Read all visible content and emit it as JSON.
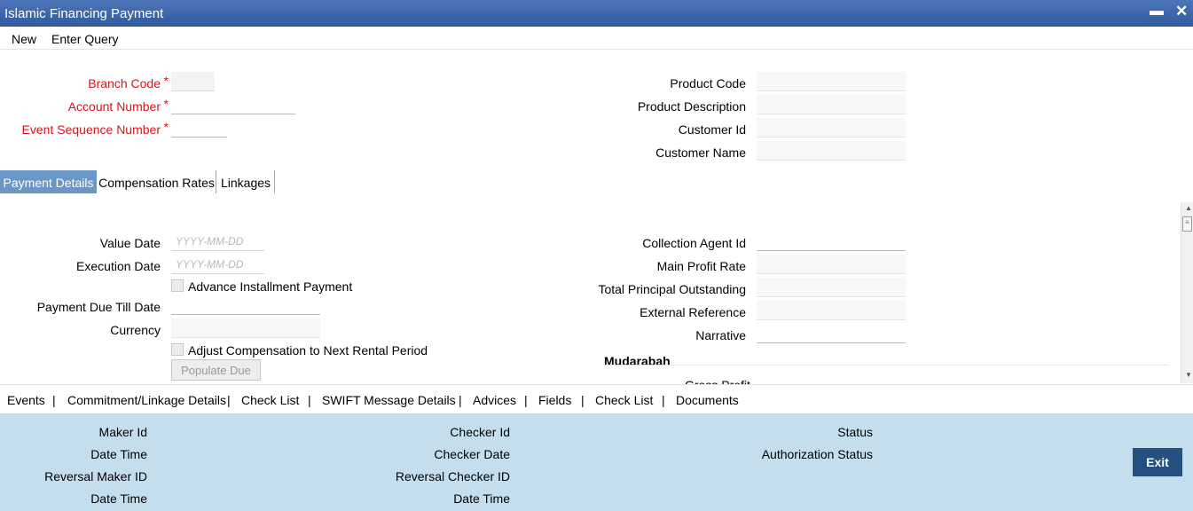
{
  "window": {
    "title": "Islamic Financing Payment"
  },
  "menu": {
    "new": "New",
    "enter_query": "Enter Query"
  },
  "header": {
    "branch_code_label": "Branch Code",
    "account_number_label": "Account Number",
    "event_sequence_label": "Event Sequence Number",
    "required_mark": "*",
    "product_code_label": "Product Code",
    "product_description_label": "Product Description",
    "customer_id_label": "Customer Id",
    "customer_name_label": "Customer Name"
  },
  "tabs": [
    {
      "label": "Payment Details",
      "active": true
    },
    {
      "label": "Compensation Rates",
      "active": false
    },
    {
      "label": "Linkages",
      "active": false
    }
  ],
  "payment": {
    "value_date_label": "Value Date",
    "value_date_placeholder": "YYYY-MM-DD",
    "execution_date_label": "Execution Date",
    "execution_date_placeholder": "YYYY-MM-DD",
    "advance_installment_label": "Advance Installment Payment",
    "payment_due_till_label": "Payment Due Till Date",
    "currency_label": "Currency",
    "adjust_compensation_label": "Adjust Compensation to Next Rental Period",
    "populate_due_label": "Populate Due",
    "collection_agent_label": "Collection Agent Id",
    "main_profit_rate_label": "Main Profit Rate",
    "total_principal_label": "Total Principal Outstanding",
    "external_reference_label": "External Reference",
    "narrative_label": "Narrative",
    "mudarabah_heading": "Mudarabah",
    "cutoff_label": "Gross Profit"
  },
  "bottom_nav": [
    "Events",
    "Commitment/Linkage Details",
    "Check List",
    "SWIFT Message Details",
    "Advices",
    "Fields",
    "Check List",
    "Documents"
  ],
  "bottom_nav_separator": "|",
  "footer": {
    "maker_id": "Maker Id",
    "date_time": "Date Time",
    "reversal_maker_id": "Reversal Maker ID",
    "date_time_2": "Date Time",
    "checker_id": "Checker Id",
    "checker_date": "Checker Date",
    "reversal_checker_id": "Reversal Checker ID",
    "date_time_3": "Date Time",
    "status": "Status",
    "authorization_status": "Authorization Status",
    "exit": "Exit"
  },
  "colors": {
    "title_bar": "#2f5a9e",
    "required_label": "#d4161b",
    "active_tab": "#6b96c8",
    "footer_bg": "#c5deee",
    "exit_button": "#254f7e"
  },
  "icons": {
    "minimize": "minimize-icon",
    "close": "close-icon",
    "scroll_up": "arrow-up-icon",
    "scroll_down": "arrow-down-icon"
  }
}
